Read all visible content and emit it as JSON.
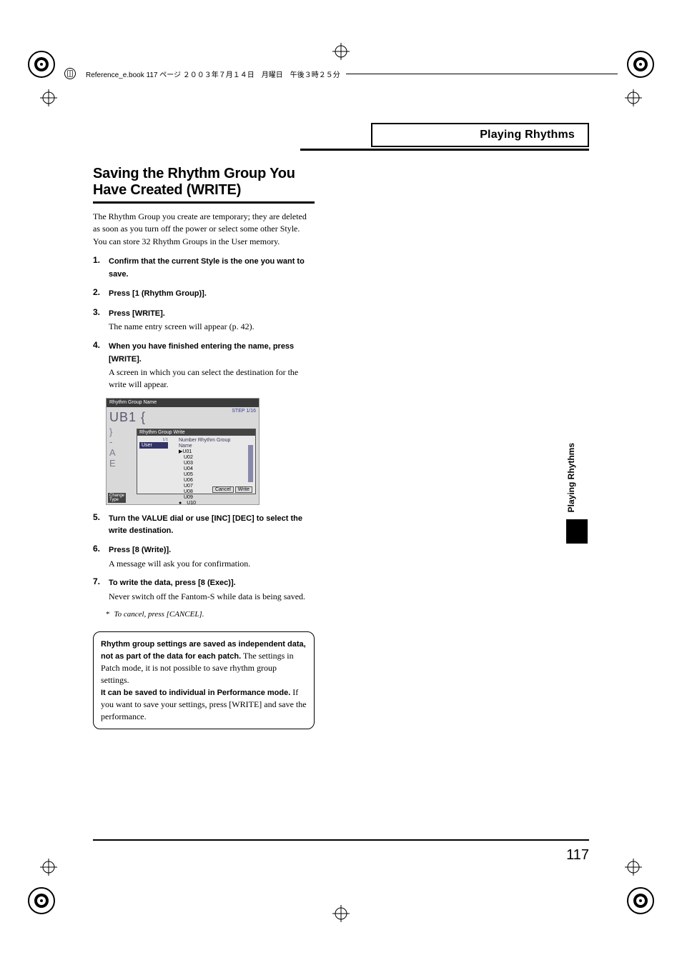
{
  "book_header": "Reference_e.book  117 ページ  ２００３年７月１４日　月曜日　午後３時２５分",
  "running_head": "Playing Rhythms",
  "title": "Saving the Rhythm Group You Have Created (WRITE)",
  "intro": "The Rhythm Group you create are temporary; they are deleted as soon as you turn off the power or select some other Style. You can store 32 Rhythm Groups in the User memory.",
  "steps": [
    {
      "num": "1.",
      "bold": "Confirm that the current Style is the one you want to save.",
      "body": ""
    },
    {
      "num": "2.",
      "bold": "Press [1 (Rhythm Group)].",
      "body": ""
    },
    {
      "num": "3.",
      "bold": "Press [WRITE].",
      "body": "The name entry screen will appear (p. 42)."
    },
    {
      "num": "4.",
      "bold": "When you have finished entering the name, press [WRITE].",
      "body": "A screen in which you can select the destination for the write will appear."
    },
    {
      "num": "5.",
      "bold": "Turn the VALUE dial or use [INC] [DEC] to select the write destination.",
      "body": ""
    },
    {
      "num": "6.",
      "bold": "Press [8 (Write)].",
      "body": "A message will ask you for confirmation."
    },
    {
      "num": "7.",
      "bold": "To write the data, press [8 (Exec)].",
      "body": "Never switch off the Fantom-S while data is being saved."
    }
  ],
  "cancel_note": {
    "ast": "*",
    "text": "To cancel, press [CANCEL]."
  },
  "info_box": {
    "part1_bold": "Rhythm group settings are saved as independent data, not as part of the data for each patch.",
    "part1_rest": " The settings in Patch mode, it is not possible to save rhythm group settings.",
    "part2_bold": "It can be saved to individual in Performance mode.",
    "part2_rest": " If you want to save your settings, press [WRITE] and save the performance."
  },
  "screenshot": {
    "titlebar": "Rhythm Group Name",
    "step_indicator": "STEP  1/16",
    "big_name": "UB1    {",
    "letters": "}\n-\nA\nE",
    "dialog_title": "Rhythm Group Write",
    "page_ind": "1/1",
    "user_tab": "User",
    "header": "Number  Rhythm Group Name",
    "items": [
      "▶U01",
      "　U02",
      "　U03",
      "　U04",
      "　U05",
      "　U06",
      "　U07",
      "　U08",
      "　U09",
      "●　U10"
    ],
    "cancel": "Cancel",
    "write": "Write",
    "footer_btn": "Change\nType"
  },
  "side_tab": "Playing Rhythms",
  "page_number": "117"
}
